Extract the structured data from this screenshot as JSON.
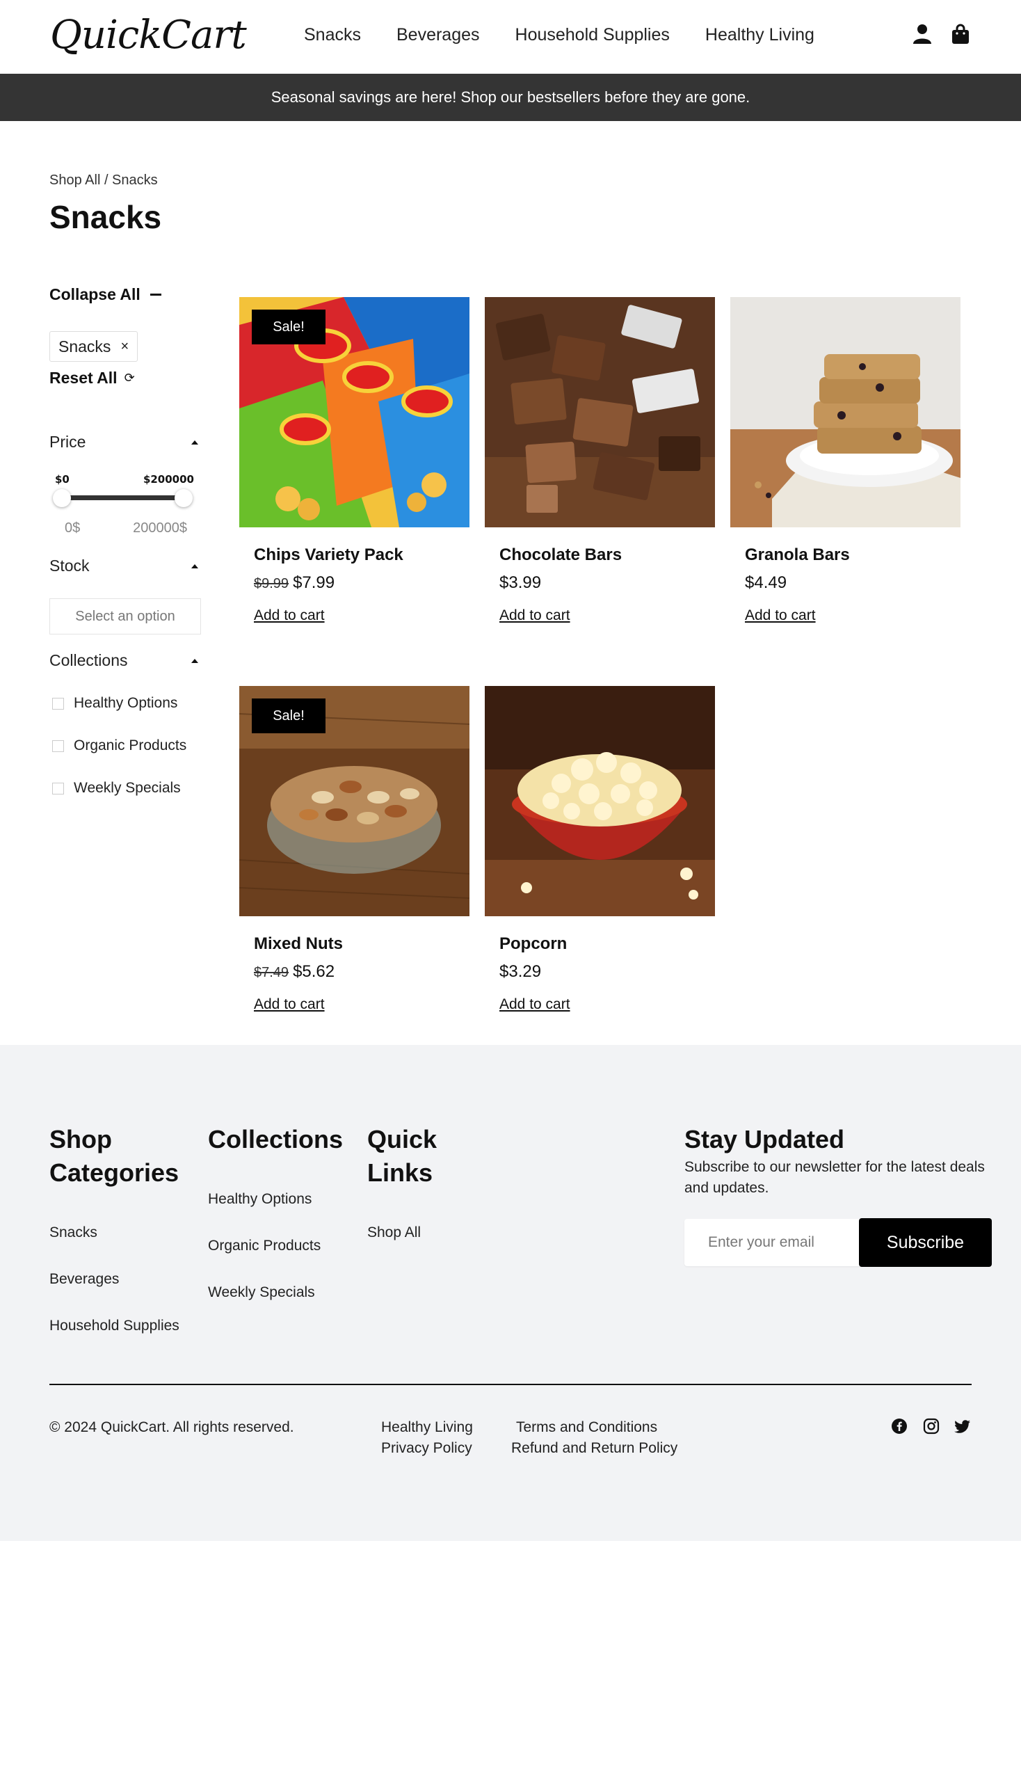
{
  "header": {
    "logo": "QuickCart",
    "nav": [
      "Snacks",
      "Beverages",
      "Household Supplies",
      "Healthy Living"
    ],
    "icons": [
      "user-icon",
      "shopping-bag-icon"
    ]
  },
  "announcement": "Seasonal savings are here! Shop our bestsellers before they are gone.",
  "breadcrumb": "Shop All / Snacks",
  "page_title": "Snacks",
  "sidebar": {
    "collapse_all": "Collapse All",
    "active_filter": "Snacks",
    "active_filter_remove": "×",
    "reset_all": "Reset All",
    "price": {
      "label": "Price",
      "min_label": "$0",
      "max_label": "$200000",
      "min_value": "0$",
      "max_value": "200000$"
    },
    "stock": {
      "label": "Stock",
      "placeholder": "Select an option"
    },
    "collections": {
      "label": "Collections",
      "options": [
        "Healthy Options",
        "Organic Products",
        "Weekly Specials"
      ]
    }
  },
  "products": [
    {
      "name": "Chips Variety Pack",
      "old_price": "$9.99",
      "price": "$7.99",
      "sale": "Sale!",
      "cta": "Add to cart"
    },
    {
      "name": "Chocolate Bars",
      "old_price": "",
      "price": "$3.99",
      "sale": "",
      "cta": "Add to cart"
    },
    {
      "name": "Granola Bars",
      "old_price": "",
      "price": "$4.49",
      "sale": "",
      "cta": "Add to cart"
    },
    {
      "name": "Mixed Nuts",
      "old_price": "$7.49",
      "price": "$5.62",
      "sale": "Sale!",
      "cta": "Add to cart"
    },
    {
      "name": "Popcorn",
      "old_price": "",
      "price": "$3.29",
      "sale": "",
      "cta": "Add to cart"
    }
  ],
  "footer": {
    "shop_categories": {
      "title_line1": "Shop",
      "title_line2": "Categories",
      "links": [
        "Snacks",
        "Beverages",
        "Household Supplies"
      ]
    },
    "collections": {
      "title": "Collections",
      "links": [
        "Healthy Options",
        "Organic Products",
        "Weekly Specials"
      ]
    },
    "quick_links": {
      "title_line1": "Quick",
      "title_line2": "Links",
      "links": [
        "Shop All"
      ]
    },
    "newsletter": {
      "title": "Stay Updated",
      "subtitle": "Subscribe to our newsletter for the latest deals and updates.",
      "placeholder": "Enter your email",
      "button": "Subscribe"
    },
    "copyright": "© 2024 QuickCart. All rights reserved.",
    "bottom_links": [
      "Healthy Living",
      "Terms and Conditions",
      "Privacy Policy",
      "Refund and Return Policy"
    ],
    "social": [
      "facebook-icon",
      "instagram-icon",
      "twitter-icon"
    ]
  }
}
